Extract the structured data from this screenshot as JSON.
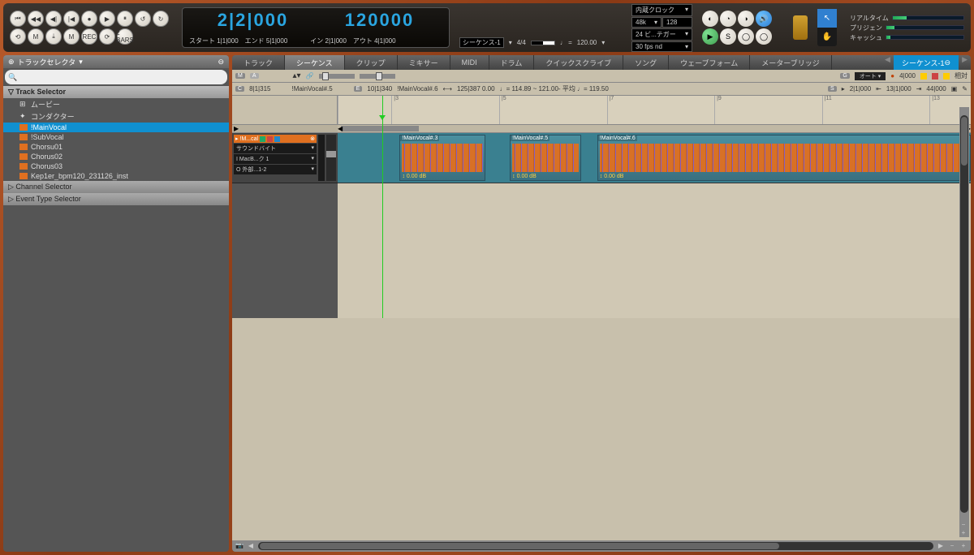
{
  "transport_icons": [
    "⏮",
    "◀◀",
    "◀|",
    "|◀",
    "●",
    "▶",
    "⏸",
    "↺",
    "↻",
    "⟲",
    "M",
    "⤓",
    "M",
    "REC",
    "⟳",
    "2 BARS"
  ],
  "counter": {
    "time1": "2|2|000",
    "time2": "120000",
    "start_lbl": "スタート",
    "start_v": "1|1|000",
    "end_lbl": "エンド",
    "end_v": "5|1|000",
    "in_lbl": "イン",
    "in_v": "2|1|000",
    "out_lbl": "アウト",
    "out_v": "4|1|000"
  },
  "seq_ctrl": {
    "seq_lbl": "シーケンス-1",
    "sig": "4/4",
    "tempo_note": "♩ =",
    "tempo": "120.00"
  },
  "clock": {
    "title": "内蔵クロック",
    "sr": "48k",
    "buf": "128",
    "bit": "24 ビ...テガー",
    "fps": "30 fps nd"
  },
  "perf": {
    "l1": "リアルタイム",
    "l2": "プリジェン",
    "l3": "キャッシュ"
  },
  "sidebar": {
    "title": "トラックセレクタ",
    "search_ph": "Q",
    "hdr": "Track Selector",
    "movie": "ムービー",
    "conductor": "コンダクター",
    "tracks": [
      "!MainVocal",
      "!SubVocal",
      "Chorsu01",
      "Chorus02",
      "Chorus03",
      "Kep1er_bpm120_231126_inst"
    ],
    "ch_sel": "Channel Selector",
    "ev_sel": "Event Type Selector"
  },
  "tabs": [
    "トラック",
    "シーケンス",
    "クリップ",
    "ミキサー",
    "MIDI",
    "ドラム",
    "クイックスクライブ",
    "ソング",
    "ウェーブフォーム",
    "メーターブリッジ"
  ],
  "tab_active": 1,
  "seq_tab": "シーケンス-1",
  "info1": {
    "m": "M",
    "a": "A",
    "g": "G",
    "auto": "オート",
    "sample": "4|000",
    "rel": "相対"
  },
  "info2": {
    "c": "C",
    "c_v": "8|1|315",
    "clip": "!MainVocal#.5",
    "e": "E",
    "e_v1": "10|1|340",
    "e_clip": "!MainVocal#.6",
    "e_v2": "125|387 0.00",
    "tempo": "♩= 114.89 ~ 121.00- 平均 ♩= 119.50",
    "s": "S",
    "s_v": "2|1|000",
    "loc1": "13|1|000",
    "loc2": "44|000"
  },
  "ruler_marks": [
    {
      "pos": 0.0,
      "lbl": ""
    },
    {
      "pos": 0.085,
      "lbl": "|3"
    },
    {
      "pos": 0.255,
      "lbl": "|5"
    },
    {
      "pos": 0.425,
      "lbl": "|7"
    },
    {
      "pos": 0.595,
      "lbl": "|9"
    },
    {
      "pos": 0.765,
      "lbl": "|11"
    },
    {
      "pos": 0.935,
      "lbl": "|13"
    }
  ],
  "track_hdr": {
    "name": "!M...cal",
    "dd1": "サウンドバイト",
    "dd2": "I MacB...ク 1",
    "dd3": "O 外部...1-2"
  },
  "clips": [
    {
      "name": "!MainVocal#.3",
      "left": 0.098,
      "width": 0.135,
      "db": "0.00 dB"
    },
    {
      "name": "!MainVocal#.5",
      "left": 0.272,
      "width": 0.112,
      "db": "0.00 dB"
    },
    {
      "name": "!MainVocal#.6",
      "left": 0.41,
      "width": 0.59,
      "db": "0.00 dB"
    }
  ]
}
